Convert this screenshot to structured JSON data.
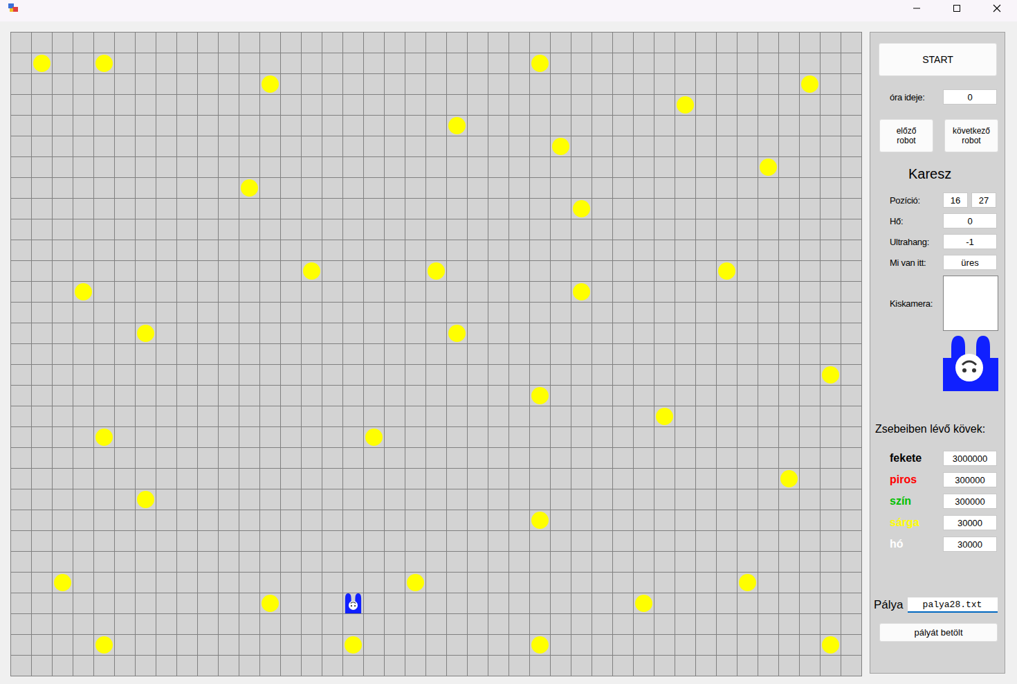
{
  "board": {
    "columns": 41,
    "rows": 31,
    "stones": [
      {
        "col": 1,
        "row": 1,
        "color": "#ffff00"
      },
      {
        "col": 4,
        "row": 1,
        "color": "#ffff00"
      },
      {
        "col": 25,
        "row": 1,
        "color": "#ffff00"
      },
      {
        "col": 12,
        "row": 2,
        "color": "#ffff00"
      },
      {
        "col": 38,
        "row": 2,
        "color": "#ffff00"
      },
      {
        "col": 32,
        "row": 3,
        "color": "#ffff00"
      },
      {
        "col": 21,
        "row": 4,
        "color": "#ffff00"
      },
      {
        "col": 26,
        "row": 5,
        "color": "#ffff00"
      },
      {
        "col": 36,
        "row": 6,
        "color": "#ffff00"
      },
      {
        "col": 11,
        "row": 7,
        "color": "#ffff00"
      },
      {
        "col": 27,
        "row": 8,
        "color": "#ffff00"
      },
      {
        "col": 14,
        "row": 11,
        "color": "#ffff00"
      },
      {
        "col": 20,
        "row": 11,
        "color": "#ffff00"
      },
      {
        "col": 34,
        "row": 11,
        "color": "#ffff00"
      },
      {
        "col": 3,
        "row": 12,
        "color": "#ffff00"
      },
      {
        "col": 27,
        "row": 12,
        "color": "#ffff00"
      },
      {
        "col": 6,
        "row": 14,
        "color": "#ffff00"
      },
      {
        "col": 21,
        "row": 14,
        "color": "#ffff00"
      },
      {
        "col": 39,
        "row": 16,
        "color": "#ffff00"
      },
      {
        "col": 25,
        "row": 17,
        "color": "#ffff00"
      },
      {
        "col": 31,
        "row": 18,
        "color": "#ffff00"
      },
      {
        "col": 4,
        "row": 19,
        "color": "#ffff00"
      },
      {
        "col": 17,
        "row": 19,
        "color": "#ffff00"
      },
      {
        "col": 37,
        "row": 21,
        "color": "#ffff00"
      },
      {
        "col": 6,
        "row": 22,
        "color": "#ffff00"
      },
      {
        "col": 25,
        "row": 23,
        "color": "#ffff00"
      },
      {
        "col": 2,
        "row": 26,
        "color": "#ffff00"
      },
      {
        "col": 19,
        "row": 26,
        "color": "#ffff00"
      },
      {
        "col": 35,
        "row": 26,
        "color": "#ffff00"
      },
      {
        "col": 12,
        "row": 27,
        "color": "#ffff00"
      },
      {
        "col": 30,
        "row": 27,
        "color": "#ffff00"
      },
      {
        "col": 4,
        "row": 29,
        "color": "#ffff00"
      },
      {
        "col": 16,
        "row": 29,
        "color": "#ffff00"
      },
      {
        "col": 25,
        "row": 29,
        "color": "#ffff00"
      },
      {
        "col": 39,
        "row": 29,
        "color": "#ffff00"
      }
    ],
    "robot": {
      "col": 16,
      "row": 27
    }
  },
  "panel": {
    "start": "START",
    "clock": {
      "label": "óra ideje:",
      "value": "0"
    },
    "prev": "előző robot",
    "next": "következő robot",
    "robot_name": "Karesz",
    "position": {
      "label": "Pozíció:",
      "x": "16",
      "y": "27"
    },
    "sensors": [
      {
        "label": "Hő:",
        "value": "0"
      },
      {
        "label": "Ultrahang:",
        "value": "-1"
      },
      {
        "label": "Mi van itt:",
        "value": "üres"
      }
    ],
    "camera_label": "Kiskamera:",
    "pockets_title": "Zsebeiben lévő kövek:",
    "pockets": [
      {
        "name": "fekete",
        "count": "3000000",
        "color": "#000000"
      },
      {
        "name": "piros",
        "count": "300000",
        "color": "#ff0000"
      },
      {
        "name": "szín",
        "count": "300000",
        "color": "#00c000"
      },
      {
        "name": "sárga",
        "count": "30000",
        "color": "#ffff00"
      },
      {
        "name": "hó",
        "count": "30000",
        "color": "#ffffff"
      }
    ],
    "map": {
      "label": "Pálya",
      "value": "palya28.txt"
    },
    "load": "pályát betölt"
  }
}
